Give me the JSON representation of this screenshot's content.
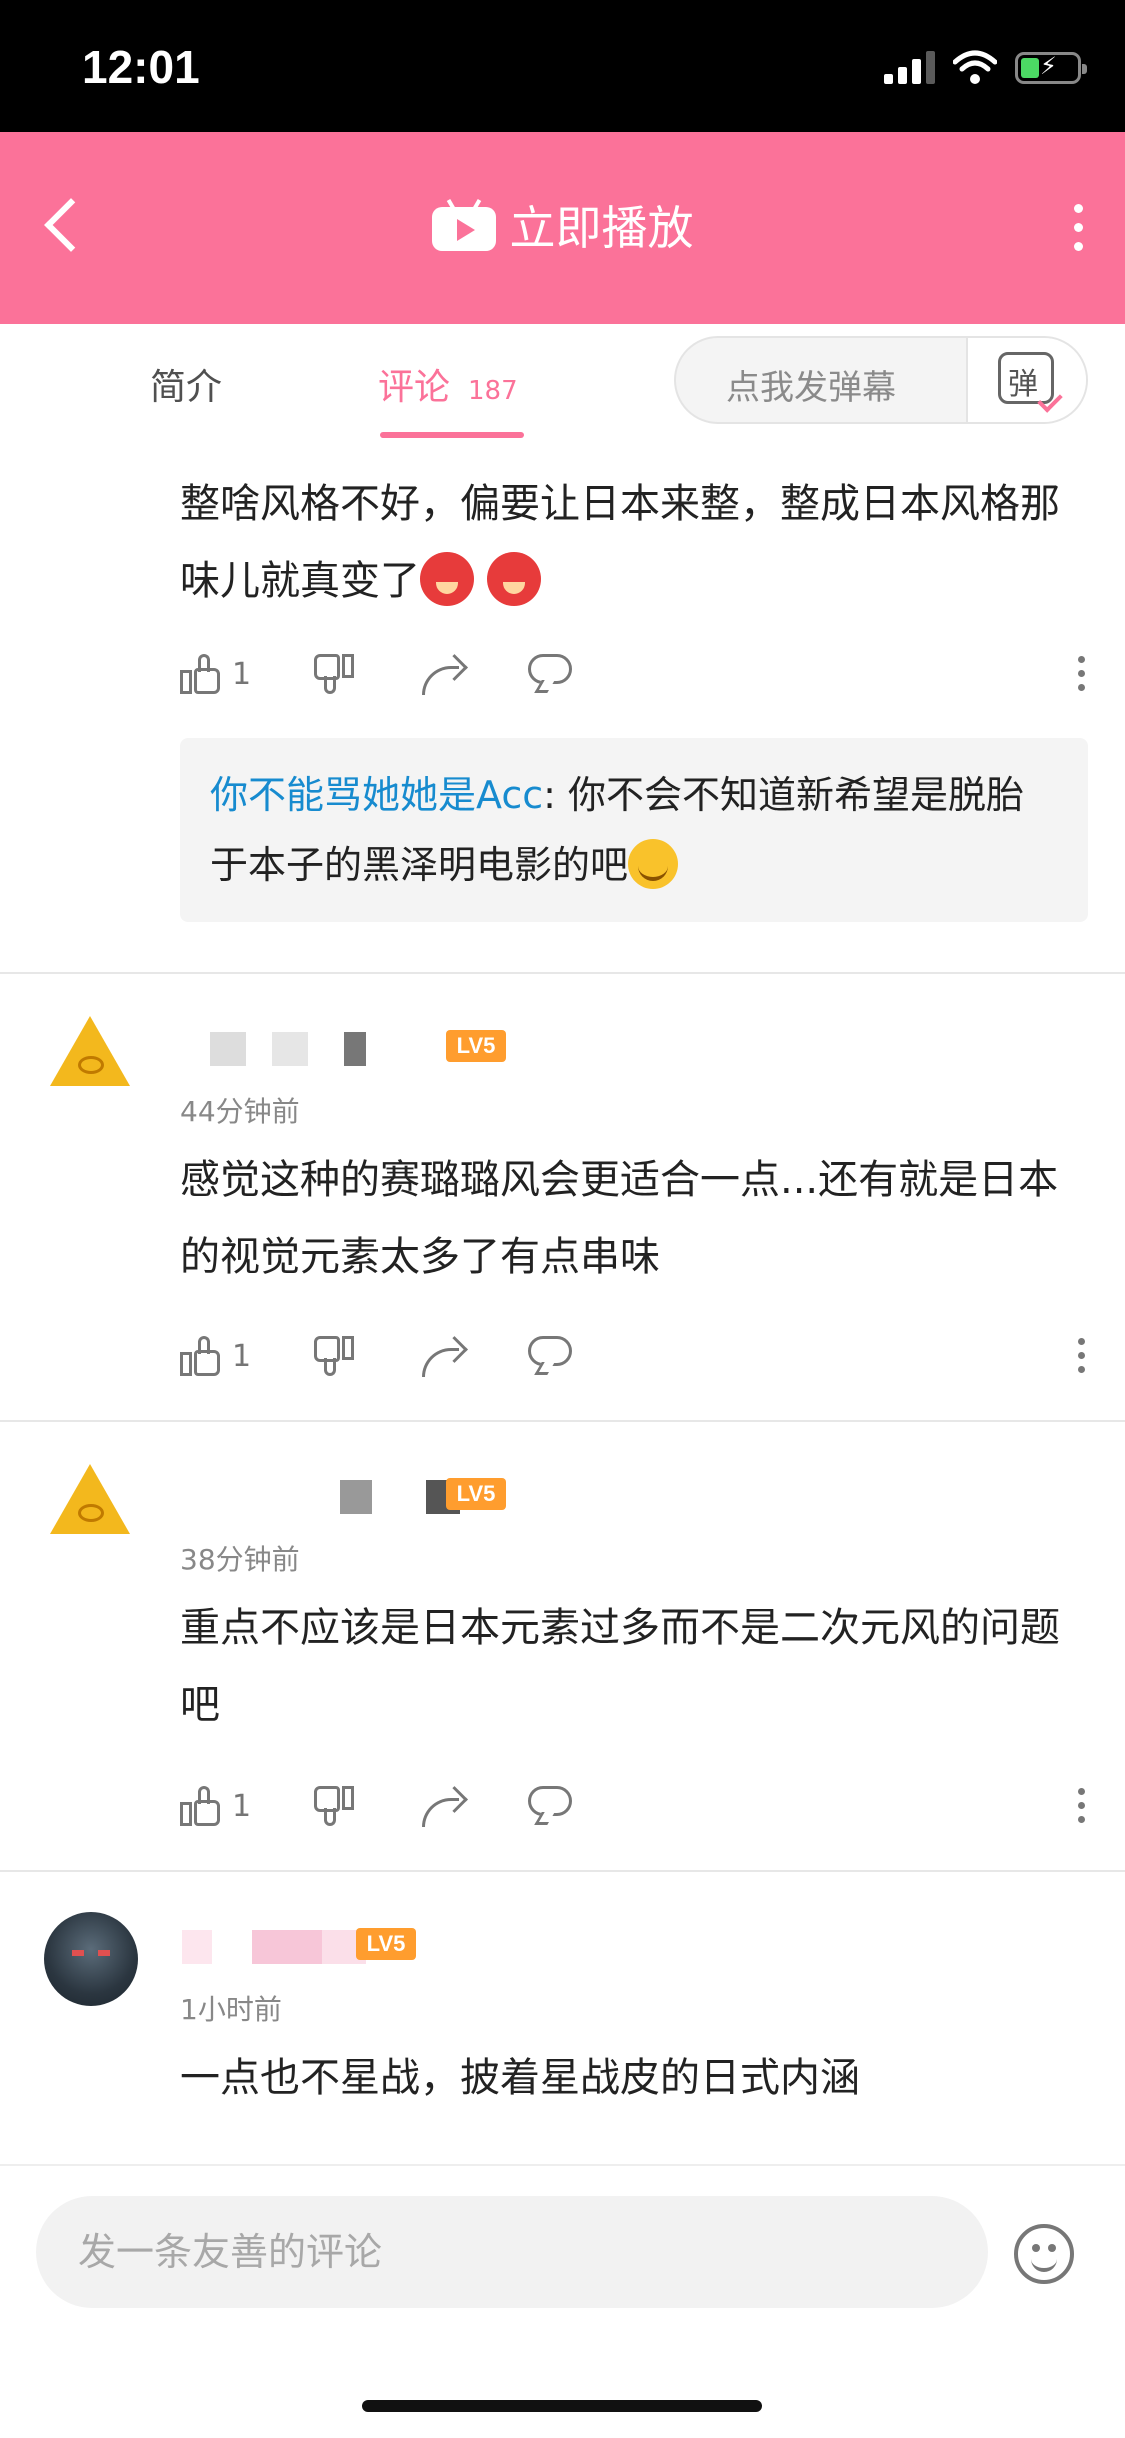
{
  "status_bar": {
    "time": "12:01"
  },
  "header": {
    "title": "立即播放"
  },
  "tabs": {
    "intro": "简介",
    "comments": "评论",
    "comments_count": "187",
    "danmaku_placeholder": "点我发弹幕",
    "danmaku_button": "弹"
  },
  "comments": [
    {
      "text": "整啥风格不好，偏要让日本来整，整成日本风格那味儿就真变了",
      "likes": "1",
      "reply": {
        "user": "你不能骂她她是Acc",
        "separator": ": ",
        "text": "你不会不知道新希望是脱胎于本子的黑泽明电影的吧"
      }
    },
    {
      "level": "LV5",
      "time": "44分钟前",
      "text": "感觉这种的赛璐璐风会更适合一点...还有就是日本的视觉元素太多了有点串味",
      "likes": "1"
    },
    {
      "level": "LV5",
      "time": "38分钟前",
      "text": "重点不应该是日本元素过多而不是二次元风的问题吧",
      "likes": "1"
    },
    {
      "level": "LV5",
      "time": "1小时前",
      "text": "一点也不星战，披着星战皮的日式内涵"
    }
  ],
  "bottom": {
    "placeholder": "发一条友善的评论"
  },
  "colors": {
    "accent": "#fb7299",
    "link": "#178bcf",
    "level_badge": "#ff9d2e"
  }
}
